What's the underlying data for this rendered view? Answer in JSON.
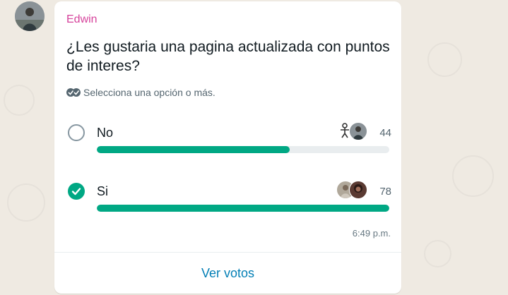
{
  "message": {
    "sender": "Edwin",
    "sender_color": "#d6449c",
    "time": "6:49 p.m."
  },
  "poll": {
    "question": "¿Les gustaria una pagina actualizada con puntos de interes?",
    "instruction": "Selecciona una opción o más.",
    "instruction_icon": "double-check-icon",
    "options": [
      {
        "label": "No",
        "votes": "44",
        "fraction": 0.66,
        "selected": false,
        "voter_icons": [
          "stick-figure-avatar",
          "person-photo-avatar"
        ]
      },
      {
        "label": "Si",
        "votes": "78",
        "fraction": 1.0,
        "selected": true,
        "voter_icons": [
          "person-photo-avatar",
          "person-photo-avatar"
        ]
      }
    ],
    "view_votes_label": "Ver votos"
  },
  "colors": {
    "accent": "#00a884",
    "link": "#027eb5",
    "background": "#efeae2"
  }
}
